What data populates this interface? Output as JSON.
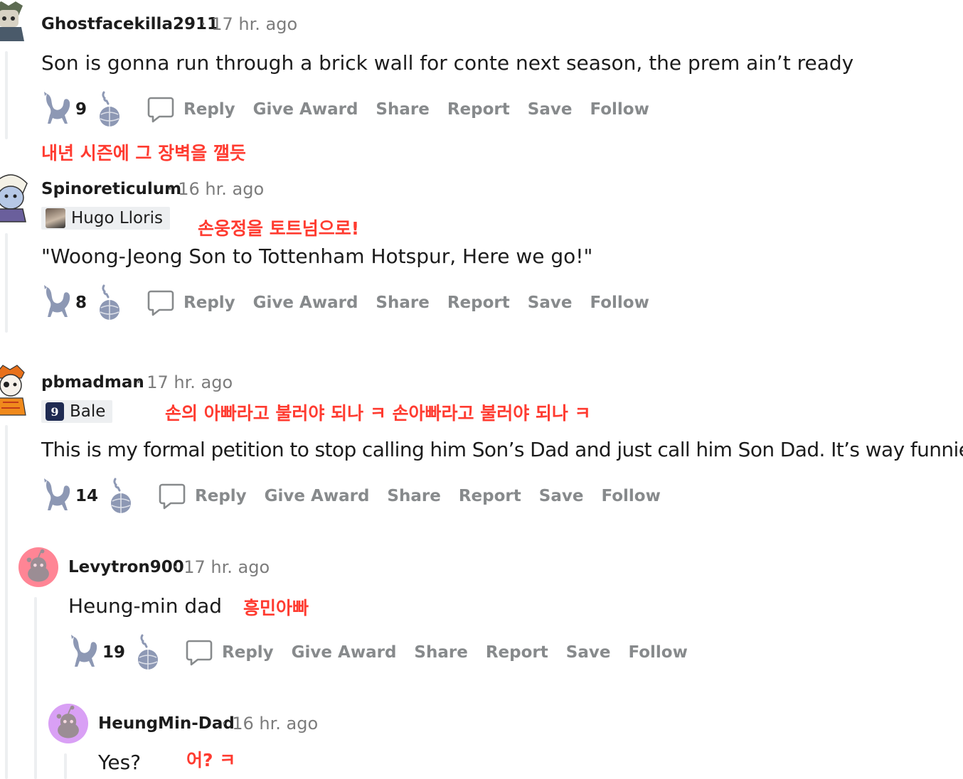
{
  "comments": [
    {
      "author": "Ghostfacekilla2911",
      "time": "· 17 hr. ago",
      "body": "Son is gonna run through a brick wall for conte next season, the prem ain’t ready",
      "annotation": "내년 시즌에 그 장벽을 깰듯",
      "score": "9"
    },
    {
      "author": "Spinoreticulum",
      "time": "· 16 hr. ago",
      "flair": "Hugo Lloris",
      "annotation": "손웅정을 토트넘으로!",
      "body": "\"Woong-Jeong Son to Tottenham Hotspur, Here we go!\"",
      "score": "8"
    },
    {
      "author": "pbmadman",
      "time": "· 17 hr. ago",
      "flair": "Bale",
      "flair_badge": "9",
      "annotation": "손의 아빠라고 불러야 되나 ㅋ 손아빠라고 불러야 되나 ㅋ",
      "body": "This is my formal petition to stop calling him Son’s Dad and just call him Son Dad. It’s way funnier.",
      "score": "14"
    },
    {
      "author": "Levytron900",
      "time": "· 17 hr. ago",
      "body": "Heung-min dad",
      "annotation": "흥민아빠",
      "score": "19"
    },
    {
      "author": "HeungMin-Dad",
      "time": "· 16 hr. ago",
      "body": "Yes?",
      "annotation": "어? ㅋ"
    }
  ],
  "actions": {
    "reply": "Reply",
    "give_award": "Give Award",
    "share": "Share",
    "report": "Report",
    "save": "Save",
    "follow": "Follow"
  },
  "icons": {
    "upvote": "cockerel-upvote-icon",
    "downvote": "cockerel-ball-downvote-icon",
    "reply": "speech-bubble-icon"
  },
  "colors": {
    "action_gray": "#878a8c",
    "icon_gray": "#8d98b4",
    "annotation_red": "#ff3b30",
    "levytron_avatar": "#ff8595",
    "heungmin_avatar": "#d9a0f5"
  }
}
